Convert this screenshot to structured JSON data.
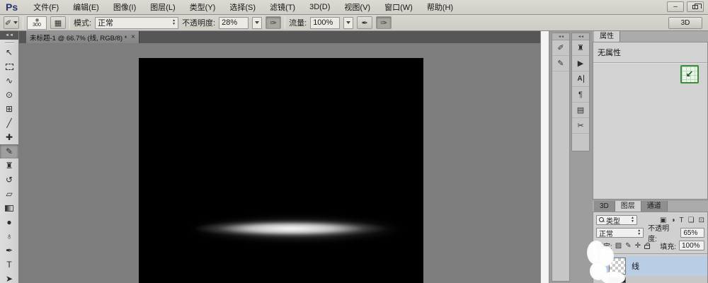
{
  "window": {
    "logo": "Ps",
    "menus": [
      "文件(F)",
      "编辑(E)",
      "图像(I)",
      "图层(L)",
      "类型(Y)",
      "选择(S)",
      "滤镜(T)",
      "3D(D)",
      "视图(V)",
      "窗口(W)",
      "帮助(H)"
    ],
    "minimize_glyph": "–"
  },
  "options_bar": {
    "tool_icon_glyph": "✐",
    "brush_tip_size": "300",
    "toggle_panel_glyph": "▦",
    "mode_label": "模式:",
    "mode_value": "正常",
    "opacity_label": "不透明度:",
    "opacity_value": "28%",
    "pressure_opacity_glyph": "✑",
    "flow_label": "流量:",
    "flow_value": "100%",
    "airbrush_glyph": "✒",
    "pressure_size_glyph": "✑",
    "right_button_label": "3D"
  },
  "document": {
    "tab_title": "未标题-1 @ 66.7% (线, RGB/8) *",
    "close_glyph": "×"
  },
  "tools": [
    {
      "name": "move-tool",
      "glyph": "↖"
    },
    {
      "name": "marquee-tool",
      "glyph": ""
    },
    {
      "name": "lasso-tool",
      "glyph": "∿"
    },
    {
      "name": "quick-selection-tool",
      "glyph": "⊙"
    },
    {
      "name": "crop-tool",
      "glyph": "⊞"
    },
    {
      "name": "eyedropper-tool",
      "glyph": "╱"
    },
    {
      "name": "spot-healing-tool",
      "glyph": "✚"
    },
    {
      "name": "brush-tool",
      "glyph": "✎",
      "selected": true
    },
    {
      "name": "clone-stamp-tool",
      "glyph": "♜"
    },
    {
      "name": "history-brush-tool",
      "glyph": "↺"
    },
    {
      "name": "eraser-tool",
      "glyph": "▱"
    },
    {
      "name": "gradient-tool",
      "glyph": ""
    },
    {
      "name": "blur-tool",
      "glyph": "●"
    },
    {
      "name": "dodge-tool",
      "glyph": "♁"
    },
    {
      "name": "pen-tool",
      "glyph": "✒"
    },
    {
      "name": "type-tool",
      "glyph": "T"
    },
    {
      "name": "path-selection-tool",
      "glyph": "➤"
    }
  ],
  "dock": {
    "collapse_glyph": "◄◄",
    "left_icons": [
      {
        "name": "brush-panel",
        "glyph": "✐"
      },
      {
        "name": "brush-presets-panel",
        "glyph": "✎"
      }
    ],
    "right_icons": [
      {
        "name": "clone-source-panel",
        "glyph": "♜"
      },
      {
        "name": "actions-panel",
        "glyph": "▶"
      },
      {
        "name": "character-panel",
        "glyph": "A"
      },
      {
        "name": "paragraph-panel",
        "glyph": "¶"
      },
      {
        "name": "layer-comps-panel",
        "glyph": "▤"
      },
      {
        "name": "notes-panel",
        "glyph": "✂"
      }
    ]
  },
  "properties_panel": {
    "tab": "属性",
    "message": "无属性",
    "green_icon_glyph": "↙"
  },
  "layers_panel": {
    "tabs": [
      "3D",
      "图层",
      "通道"
    ],
    "active_tab": "图层",
    "filter_label": "类型",
    "filter_icons": [
      {
        "name": "filter-pixel-layers",
        "glyph": "▣"
      },
      {
        "name": "filter-adjustment-layers",
        "glyph": "◑"
      },
      {
        "name": "filter-type-layers",
        "glyph": "T"
      },
      {
        "name": "filter-shape-layers",
        "glyph": "❏"
      },
      {
        "name": "filter-smart-objects",
        "glyph": "⊡"
      },
      {
        "name": "lock-transparent",
        "glyph": "▨"
      },
      {
        "name": "lock-pixels",
        "glyph": "✎"
      },
      {
        "name": "lock-position",
        "glyph": "✛"
      }
    ],
    "blend_mode": "正常",
    "opacity_label": "不透明度:",
    "opacity_value": "65%",
    "lock_label": "锁定:",
    "fill_label": "填充:",
    "fill_value": "100%",
    "layer_name": "线"
  },
  "colors": {
    "selected_layer": "#b9cde5",
    "canvas_bg": "#000000",
    "pasteboard": "#7d7d7d",
    "accent_green": "#3d8b3d"
  }
}
